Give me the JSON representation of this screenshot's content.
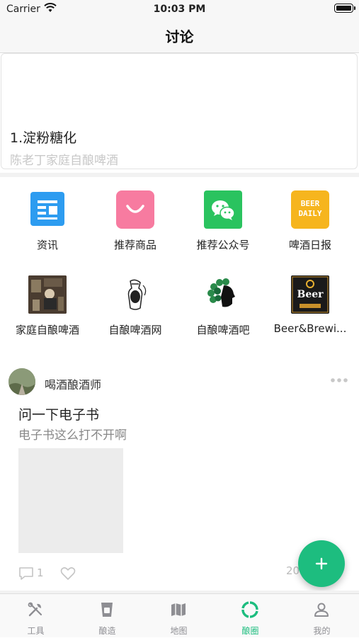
{
  "status_bar": {
    "carrier": "Carrier",
    "time": "10:03 PM"
  },
  "nav": {
    "title": "讨论"
  },
  "banner": {
    "title": "1.淀粉糖化",
    "subtitle": "陈老丁家庭自酿啤酒"
  },
  "grid": {
    "items": [
      {
        "label": "资讯",
        "icon": "news-icon"
      },
      {
        "label": "推荐商品",
        "icon": "shopping-bag-icon"
      },
      {
        "label": "推荐公众号",
        "icon": "wechat-icon"
      },
      {
        "label": "啤酒日报",
        "icon": "beer-daily-icon",
        "badge_line1": "BEER",
        "badge_line2": "DAILY"
      },
      {
        "label": "家庭自酿啤酒",
        "icon": "home-brew-thumbnail-icon"
      },
      {
        "label": "自酿啤酒网",
        "icon": "brew-web-logo-icon"
      },
      {
        "label": "自酿啤酒吧",
        "icon": "hop-head-logo-icon"
      },
      {
        "label": "Beer&Brewi...",
        "icon": "beer-brewing-logo-icon",
        "badge_text": "Beer"
      }
    ]
  },
  "post": {
    "author": "喝酒酿酒师",
    "title": "问一下电子书",
    "body": "电子书这么打不开啊",
    "comment_count": "1",
    "date": "20"
  },
  "tabbar": {
    "items": [
      {
        "label": "工具",
        "icon": "tools-icon"
      },
      {
        "label": "酿造",
        "icon": "brew-cup-icon"
      },
      {
        "label": "地图",
        "icon": "map-icon"
      },
      {
        "label": "酿圈",
        "icon": "circle-icon",
        "active": true
      },
      {
        "label": "我的",
        "icon": "profile-icon"
      }
    ]
  },
  "colors": {
    "accent": "#1dbd7f",
    "inactive": "#8e8e93",
    "news_blue": "#2d9cf0",
    "shop_pink": "#f77ba0",
    "wechat_green": "#2ac35f",
    "beer_yellow": "#f6b51e"
  }
}
